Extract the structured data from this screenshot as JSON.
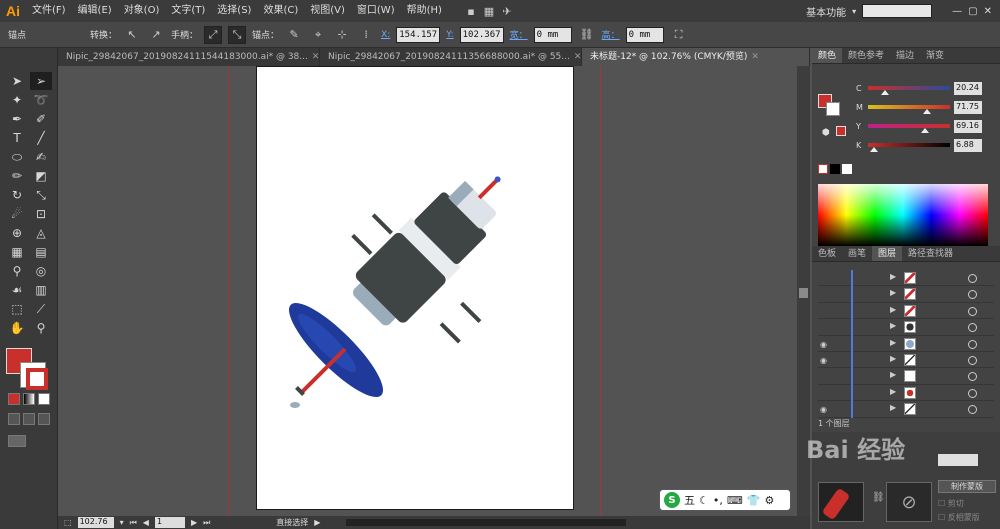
{
  "app": {
    "logo": "Ai"
  },
  "menu": [
    "文件(F)",
    "编辑(E)",
    "对象(O)",
    "文字(T)",
    "选择(S)",
    "效果(C)",
    "视图(V)",
    "窗口(W)",
    "帮助(H)"
  ],
  "workspace": "基本功能",
  "control": {
    "selection_label": "锚点",
    "convert_label": "转换：",
    "handles_label": "手柄：",
    "anchors_label": "锚点：",
    "x_label": "X:",
    "x_value": "154.157",
    "y_label": "Y:",
    "y_value": "102.367",
    "w_label": "宽：",
    "w_value": "0 mm",
    "h_label": "高：",
    "h_value": "0 mm"
  },
  "tabs": [
    {
      "label": "Nipic_29842067_20190824111544183000.ai* @ 38...",
      "active": false
    },
    {
      "label": "Nipic_29842067_20190824111356688000.ai* @ 55...",
      "active": false
    },
    {
      "label": "未标题-12* @ 102.76% (CMYK/预览)",
      "active": true
    }
  ],
  "tools": [
    "selection-tool-icon",
    "direct-selection-tool-icon",
    "magic-wand-icon",
    "lasso-icon",
    "pen-icon",
    "curvature-icon",
    "type-icon",
    "line-icon",
    "ellipse-icon",
    "paintbrush-icon",
    "pencil-icon",
    "eraser-icon",
    "rotate-icon",
    "scale-icon",
    "warp-icon",
    "free-transform-icon",
    "shape-builder-icon",
    "perspective-icon",
    "mesh-icon",
    "gradient-icon",
    "eyedropper-icon",
    "blend-icon",
    "symbol-sprayer-icon",
    "column-graph-icon",
    "artboard-icon",
    "slice-icon",
    "hand-icon",
    "zoom-icon"
  ],
  "colors": {
    "fill": "#c9302c",
    "accent": "#4e7bd8",
    "guide": "#a33333"
  },
  "color_panel": {
    "tabs": [
      "颜色",
      "颜色参考",
      "描边",
      "渐变"
    ],
    "sliders": [
      {
        "letter": "C",
        "value": "20.24",
        "pos": 0.2024
      },
      {
        "letter": "M",
        "value": "71.75",
        "pos": 0.7175
      },
      {
        "letter": "Y",
        "value": "69.16",
        "pos": 0.6916
      },
      {
        "letter": "K",
        "value": "6.88",
        "pos": 0.0688
      }
    ]
  },
  "layers_panel": {
    "tabs": [
      "色板",
      "画笔",
      "图层",
      "路径查找器"
    ],
    "rows": [
      {
        "eye": false,
        "thumb": "red-slash"
      },
      {
        "eye": false,
        "thumb": "red-slash"
      },
      {
        "eye": false,
        "thumb": "red-slash"
      },
      {
        "eye": false,
        "thumb": "dark-diamond"
      },
      {
        "eye": true,
        "thumb": "blue-circle"
      },
      {
        "eye": true,
        "thumb": "slash"
      },
      {
        "eye": false,
        "thumb": "blank"
      },
      {
        "eye": false,
        "thumb": "red-shape"
      },
      {
        "eye": true,
        "thumb": "slash"
      }
    ],
    "layer_count": "1 个图层"
  },
  "lower_panel": {
    "make_mask": "制作蒙版",
    "clip": "剪切",
    "invert_mask": "反相蒙版"
  },
  "status": {
    "zoom": "102.76",
    "page": "1",
    "tool": "直接选择"
  },
  "watermark": "Bai 经验",
  "ime": {
    "logo": "S",
    "mode": "五"
  }
}
